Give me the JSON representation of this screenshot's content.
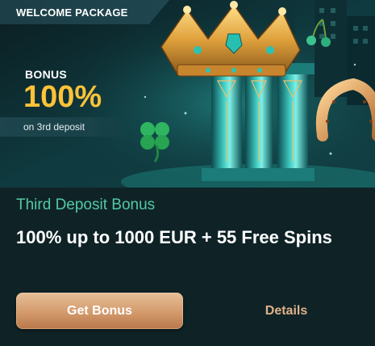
{
  "banner": {
    "ribbon_label": "WELCOME PACKAGE",
    "bonus_label": "BONUS",
    "bonus_value": "100%",
    "bonus_sub": "on 3rd deposit"
  },
  "offer": {
    "subtitle": "Third Deposit Bonus",
    "headline": "100% up to 1000 EUR + 55 Free Spins"
  },
  "actions": {
    "primary_label": "Get Bonus",
    "secondary_label": "Details"
  },
  "colors": {
    "background": "#0f2327",
    "accent_gold": "#ffc239",
    "subtitle_green": "#53c9a3",
    "button_copper": "#d39a6c",
    "details_text": "#e0b189"
  }
}
